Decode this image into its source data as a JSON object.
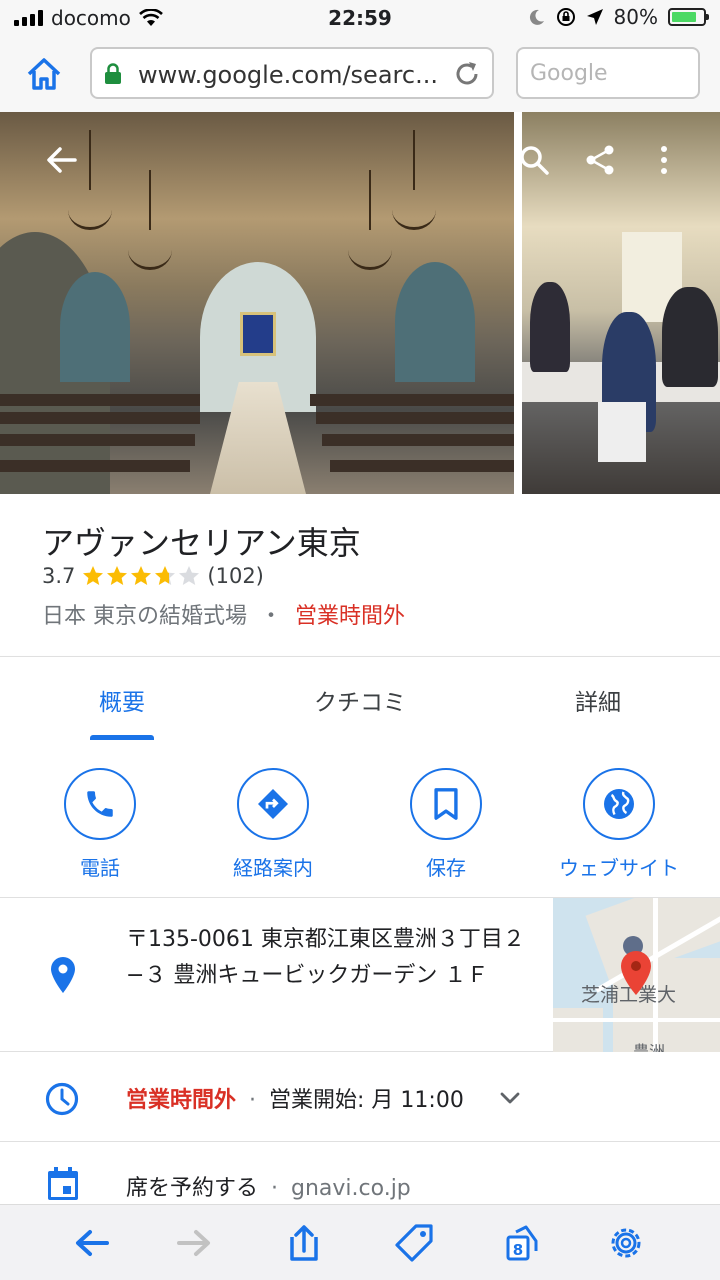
{
  "status_bar": {
    "carrier": "docomo",
    "time": "22:59",
    "battery": "80%"
  },
  "browser": {
    "url": "www.google.com/searc...",
    "search_placeholder": "Google"
  },
  "place": {
    "name": "アヴァンセリアン東京",
    "rating": "3.7",
    "rating_value": 3.7,
    "review_count": "(102)",
    "category": "日本 東京の結婚式場",
    "separator": "・",
    "status": "営業時間外"
  },
  "tabs": [
    {
      "label": "概要",
      "active": true
    },
    {
      "label": "クチコミ",
      "active": false
    },
    {
      "label": "詳細",
      "active": false
    }
  ],
  "actions": [
    {
      "label": "電話",
      "icon": "phone-icon"
    },
    {
      "label": "経路案内",
      "icon": "directions-icon"
    },
    {
      "label": "保存",
      "icon": "bookmark-icon"
    },
    {
      "label": "ウェブサイト",
      "icon": "globe-icon"
    }
  ],
  "address": {
    "text": "〒135-0061 東京都江東区豊洲３丁目２−３ 豊洲キュービックガーデン １Ｆ",
    "map_label": "芝浦工業大",
    "map_label_2": "豊洲"
  },
  "hours": {
    "status": "営業時間外",
    "separator": "·",
    "opens": "営業開始: 月 11:00"
  },
  "reservation": {
    "label": "席を予約する",
    "separator": "·",
    "source": "gnavi.co.jp"
  },
  "colors": {
    "accent": "#1a73e8",
    "closed_red": "#d93025",
    "star": "#fbbc04"
  }
}
